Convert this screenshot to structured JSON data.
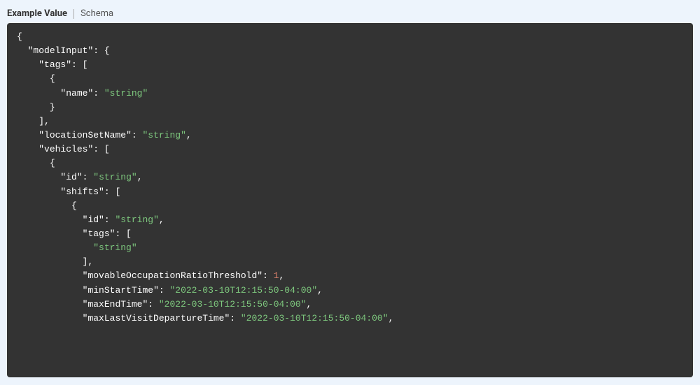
{
  "tabs": {
    "example_value": "Example Value",
    "schema": "Schema"
  },
  "code": {
    "keys": {
      "modelInput": "modelInput",
      "tags": "tags",
      "name": "name",
      "locationSetName": "locationSetName",
      "vehicles": "vehicles",
      "id": "id",
      "shifts": "shifts",
      "movableOccupationRatioThreshold": "movableOccupationRatioThreshold",
      "minStartTime": "minStartTime",
      "maxEndTime": "maxEndTime",
      "maxLastVisitDepartureTime": "maxLastVisitDepartureTime"
    },
    "values": {
      "string": "string",
      "one": "1",
      "datetime": "2022-03-10T12:15:50-04:00"
    }
  }
}
